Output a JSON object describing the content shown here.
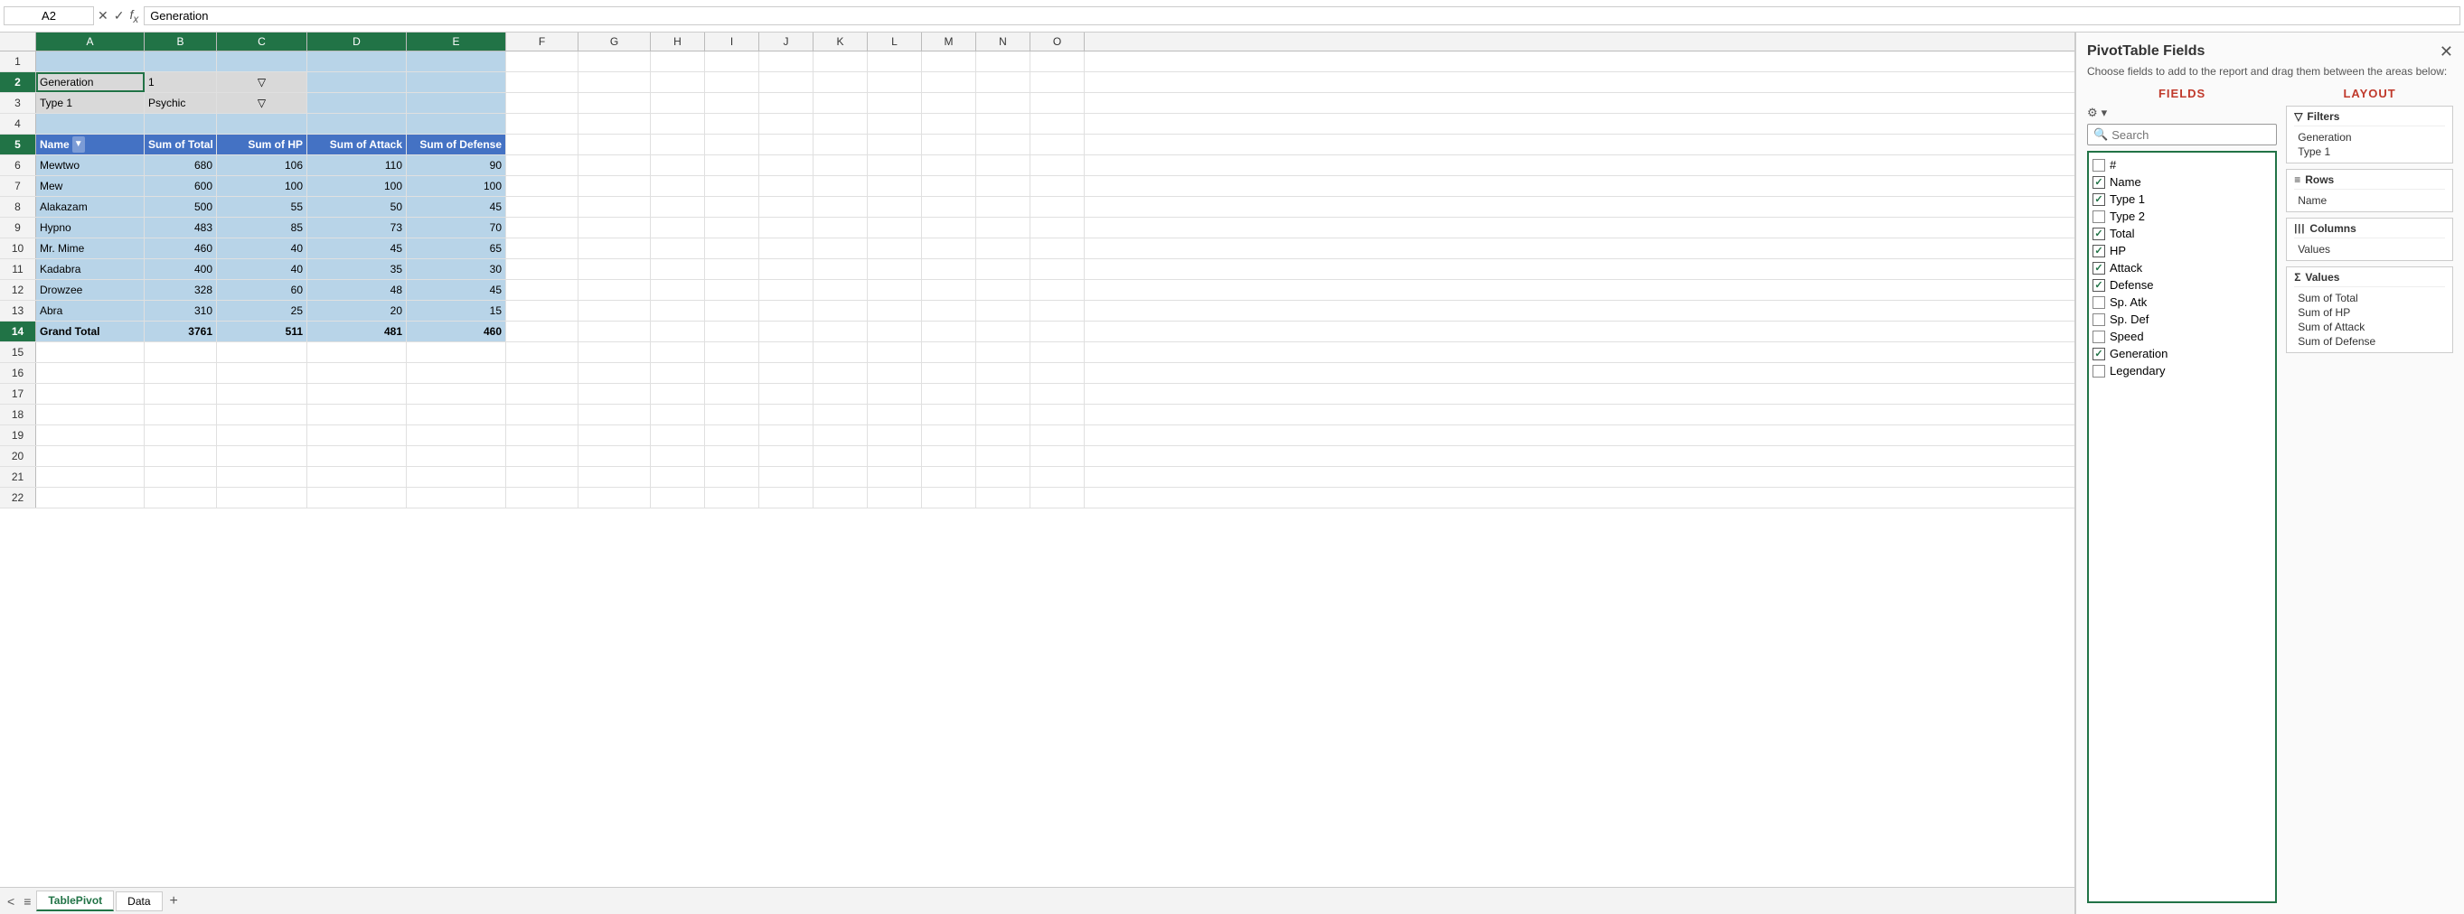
{
  "formulaBar": {
    "cellRef": "A2",
    "formula": "Generation"
  },
  "columns": [
    "A",
    "B",
    "C",
    "D",
    "E",
    "F",
    "G",
    "H",
    "I",
    "J",
    "K",
    "L",
    "M",
    "N",
    "O"
  ],
  "selectedCols": [
    "A",
    "B",
    "C",
    "D",
    "E"
  ],
  "rows": [
    {
      "num": 2,
      "cells": [
        {
          "val": "Generation",
          "class": "filter-cell"
        },
        {
          "val": "1",
          "class": "filter-cell"
        },
        {
          "val": "",
          "class": "filter-cell filter-icon"
        },
        {
          "val": ""
        },
        {
          "val": ""
        }
      ]
    },
    {
      "num": 3,
      "cells": [
        {
          "val": "Type 1",
          "class": "filter-cell"
        },
        {
          "val": "Psychic",
          "class": "filter-cell"
        },
        {
          "val": "",
          "class": "filter-cell filter-icon"
        },
        {
          "val": ""
        },
        {
          "val": ""
        }
      ]
    },
    {
      "num": 4,
      "cells": [
        {
          "val": ""
        },
        {
          "val": ""
        },
        {
          "val": ""
        },
        {
          "val": ""
        },
        {
          "val": ""
        }
      ]
    },
    {
      "num": 5,
      "cells": [
        {
          "val": "Name",
          "class": "header-cell",
          "isHeader": true
        },
        {
          "val": "Sum of Total",
          "class": "header-cell num",
          "isHeader": true
        },
        {
          "val": "Sum of HP",
          "class": "header-cell num",
          "isHeader": true
        },
        {
          "val": "Sum of Attack",
          "class": "header-cell num",
          "isHeader": true
        },
        {
          "val": "Sum of Defense",
          "class": "header-cell num",
          "isHeader": true
        }
      ]
    },
    {
      "num": 6,
      "cells": [
        {
          "val": "Mewtwo",
          "class": ""
        },
        {
          "val": "680",
          "class": "num"
        },
        {
          "val": "106",
          "class": "num"
        },
        {
          "val": "110",
          "class": "num"
        },
        {
          "val": "90",
          "class": "num"
        }
      ]
    },
    {
      "num": 7,
      "cells": [
        {
          "val": "Mew",
          "class": ""
        },
        {
          "val": "600",
          "class": "num"
        },
        {
          "val": "100",
          "class": "num"
        },
        {
          "val": "100",
          "class": "num"
        },
        {
          "val": "100",
          "class": "num"
        }
      ]
    },
    {
      "num": 8,
      "cells": [
        {
          "val": "Alakazam",
          "class": ""
        },
        {
          "val": "500",
          "class": "num"
        },
        {
          "val": "55",
          "class": "num"
        },
        {
          "val": "50",
          "class": "num"
        },
        {
          "val": "45",
          "class": "num"
        }
      ]
    },
    {
      "num": 9,
      "cells": [
        {
          "val": "Hypno",
          "class": ""
        },
        {
          "val": "483",
          "class": "num"
        },
        {
          "val": "85",
          "class": "num"
        },
        {
          "val": "73",
          "class": "num"
        },
        {
          "val": "70",
          "class": "num"
        }
      ]
    },
    {
      "num": 10,
      "cells": [
        {
          "val": "Mr. Mime",
          "class": ""
        },
        {
          "val": "460",
          "class": "num"
        },
        {
          "val": "40",
          "class": "num"
        },
        {
          "val": "45",
          "class": "num"
        },
        {
          "val": "65",
          "class": "num"
        }
      ]
    },
    {
      "num": 11,
      "cells": [
        {
          "val": "Kadabra",
          "class": ""
        },
        {
          "val": "400",
          "class": "num"
        },
        {
          "val": "40",
          "class": "num"
        },
        {
          "val": "35",
          "class": "num"
        },
        {
          "val": "30",
          "class": "num"
        }
      ]
    },
    {
      "num": 12,
      "cells": [
        {
          "val": "Drowzee",
          "class": ""
        },
        {
          "val": "328",
          "class": "num"
        },
        {
          "val": "60",
          "class": "num"
        },
        {
          "val": "48",
          "class": "num"
        },
        {
          "val": "45",
          "class": "num"
        }
      ]
    },
    {
      "num": 13,
      "cells": [
        {
          "val": "Abra",
          "class": ""
        },
        {
          "val": "310",
          "class": "num"
        },
        {
          "val": "25",
          "class": "num"
        },
        {
          "val": "20",
          "class": "num"
        },
        {
          "val": "15",
          "class": "num"
        }
      ]
    },
    {
      "num": 14,
      "cells": [
        {
          "val": "Grand Total",
          "class": "grand-total"
        },
        {
          "val": "3761",
          "class": "num grand-total"
        },
        {
          "val": "511",
          "class": "num grand-total"
        },
        {
          "val": "481",
          "class": "num grand-total"
        },
        {
          "val": "460",
          "class": "num grand-total"
        }
      ]
    },
    {
      "num": 15,
      "cells": [
        {
          "val": ""
        },
        {
          "val": ""
        },
        {
          "val": ""
        },
        {
          "val": ""
        },
        {
          "val": ""
        }
      ]
    },
    {
      "num": 16,
      "cells": [
        {
          "val": ""
        },
        {
          "val": ""
        },
        {
          "val": ""
        },
        {
          "val": ""
        },
        {
          "val": ""
        }
      ]
    },
    {
      "num": 17,
      "cells": [
        {
          "val": ""
        },
        {
          "val": ""
        },
        {
          "val": ""
        },
        {
          "val": ""
        },
        {
          "val": ""
        }
      ]
    },
    {
      "num": 18,
      "cells": [
        {
          "val": ""
        },
        {
          "val": ""
        },
        {
          "val": ""
        },
        {
          "val": ""
        },
        {
          "val": ""
        }
      ]
    },
    {
      "num": 19,
      "cells": [
        {
          "val": ""
        },
        {
          "val": ""
        },
        {
          "val": ""
        },
        {
          "val": ""
        },
        {
          "val": ""
        }
      ]
    },
    {
      "num": 20,
      "cells": [
        {
          "val": ""
        },
        {
          "val": ""
        },
        {
          "val": ""
        },
        {
          "val": ""
        },
        {
          "val": ""
        }
      ]
    },
    {
      "num": 21,
      "cells": [
        {
          "val": ""
        },
        {
          "val": ""
        },
        {
          "val": ""
        },
        {
          "val": ""
        },
        {
          "val": ""
        }
      ]
    },
    {
      "num": 22,
      "cells": [
        {
          "val": ""
        },
        {
          "val": ""
        },
        {
          "val": ""
        },
        {
          "val": ""
        },
        {
          "val": ""
        }
      ]
    }
  ],
  "pivotPanel": {
    "title": "PivotTable Fields",
    "description": "Choose fields to add to the report and drag them between the areas below:",
    "fieldsLabel": "FIELDS",
    "layoutLabel": "LAYOUT",
    "searchPlaceholder": "Search",
    "fields": [
      {
        "name": "#",
        "checked": false
      },
      {
        "name": "Name",
        "checked": true
      },
      {
        "name": "Type 1",
        "checked": true
      },
      {
        "name": "Type 2",
        "checked": false
      },
      {
        "name": "Total",
        "checked": true
      },
      {
        "name": "HP",
        "checked": true
      },
      {
        "name": "Attack",
        "checked": true
      },
      {
        "name": "Defense",
        "checked": true
      },
      {
        "name": "Sp. Atk",
        "checked": false
      },
      {
        "name": "Sp. Def",
        "checked": false
      },
      {
        "name": "Speed",
        "checked": false
      },
      {
        "name": "Generation",
        "checked": true
      },
      {
        "name": "Legendary",
        "checked": false
      }
    ],
    "layout": {
      "filters": {
        "icon": "▽",
        "label": "Filters",
        "items": [
          "Generation",
          "Type 1"
        ]
      },
      "rows": {
        "icon": "≡",
        "label": "Rows",
        "items": [
          "Name"
        ]
      },
      "columns": {
        "icon": "|||",
        "label": "Columns",
        "items": [
          "Values"
        ]
      },
      "values": {
        "icon": "Σ",
        "label": "Values",
        "items": [
          "Sum of Total",
          "Sum of HP",
          "Sum of Attack",
          "Sum of Defense"
        ]
      }
    }
  },
  "sheets": [
    {
      "name": "TablePivot",
      "active": true
    },
    {
      "name": "Data",
      "active": false
    }
  ]
}
